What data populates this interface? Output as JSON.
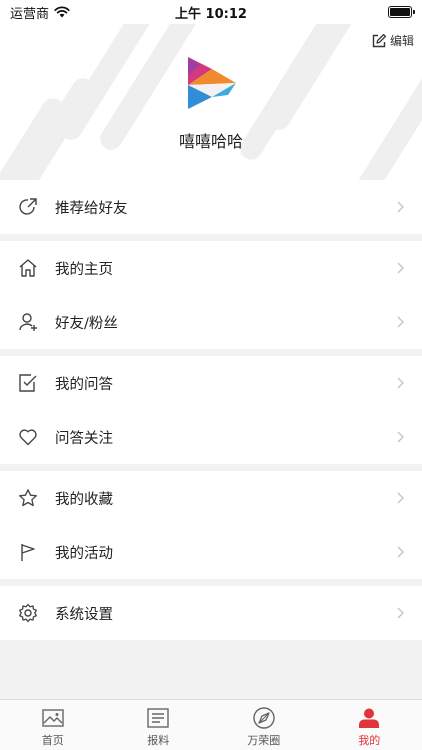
{
  "status_bar": {
    "carrier": "运营商",
    "time": "上午 10:12"
  },
  "header": {
    "edit_label": "编辑",
    "username": "嘻嘻哈哈"
  },
  "menu": {
    "recommend": "推荐给好友",
    "homepage": "我的主页",
    "friends": "好友/粉丝",
    "qa": "我的问答",
    "qa_follow": "问答关注",
    "favorites": "我的收藏",
    "activities": "我的活动",
    "settings": "系统设置"
  },
  "tabbar": {
    "items": [
      {
        "label": "首页",
        "icon": "image-icon"
      },
      {
        "label": "报料",
        "icon": "news-icon"
      },
      {
        "label": "万荣圈",
        "icon": "compass-icon"
      },
      {
        "label": "我的",
        "icon": "user-icon"
      }
    ],
    "active_index": 3,
    "active_color": "#e0333a"
  }
}
